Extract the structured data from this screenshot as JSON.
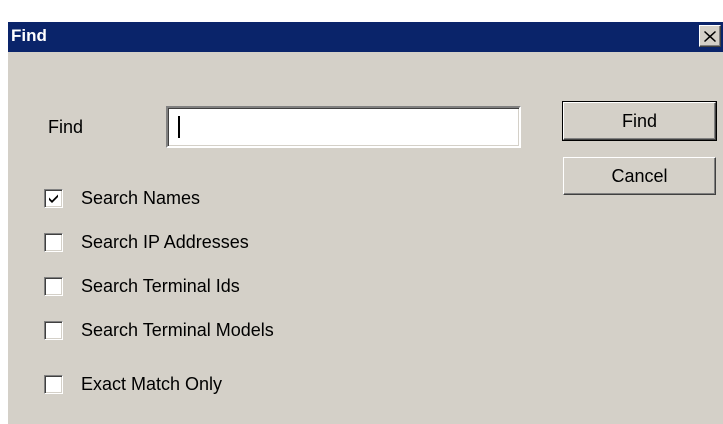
{
  "window": {
    "title": "Find",
    "close_icon": "close-icon"
  },
  "form": {
    "find_label": "Find",
    "find_value": "",
    "find_placeholder": ""
  },
  "buttons": {
    "find_label": "Find",
    "cancel_label": "Cancel"
  },
  "options": [
    {
      "label": "Search Names",
      "checked": true
    },
    {
      "label": "Search IP Addresses",
      "checked": false
    },
    {
      "label": "Search Terminal Ids",
      "checked": false
    },
    {
      "label": "Search Terminal Models",
      "checked": false
    },
    {
      "label": "Exact Match Only",
      "checked": false
    }
  ]
}
